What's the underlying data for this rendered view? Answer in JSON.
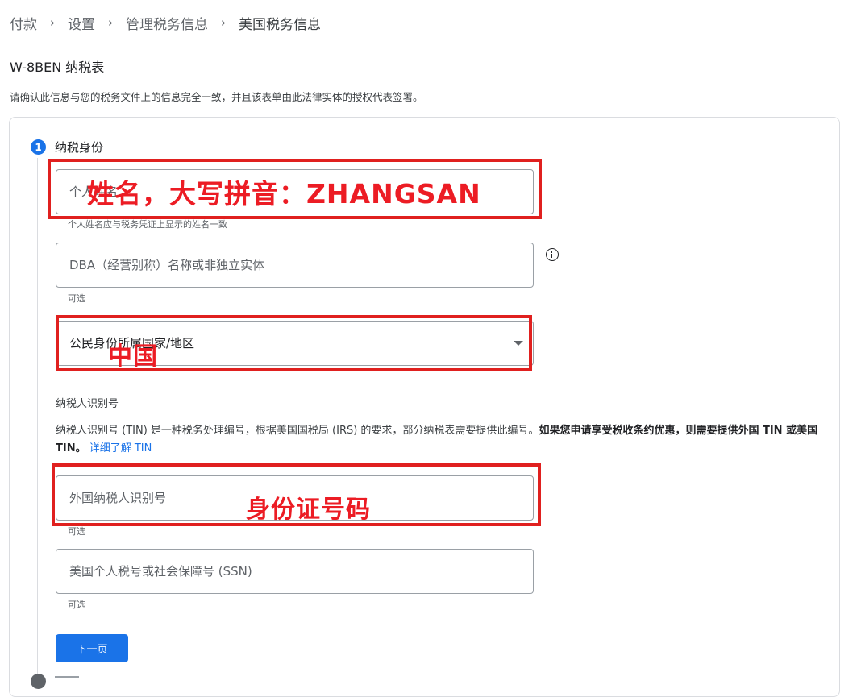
{
  "breadcrumb": {
    "items": [
      "付款",
      "设置",
      "管理税务信息",
      "美国税务信息"
    ],
    "separator": "›"
  },
  "form": {
    "title": "W-8BEN 纳税表",
    "description": "请确认此信息与您的税务文件上的信息完全一致，并且该表单由此法律实体的授权代表签署。"
  },
  "step1": {
    "number": "1",
    "label": "纳税身份",
    "name_field": {
      "placeholder": "个人姓名",
      "helper": "个人姓名应与税务凭证上显示的姓名一致"
    },
    "dba_field": {
      "placeholder": "DBA（经营别称）名称或非独立实体",
      "helper": "可选"
    },
    "country_select": {
      "label": "公民身份所属国家/地区"
    },
    "tin": {
      "heading": "纳税人识别号",
      "description": "纳税人识别号 (TIN) 是一种税务处理编号，根据美国国税局 (IRS) 的要求，部分纳税表需要提供此编号。",
      "description_bold": "如果您申请享受税收条约优惠，则需要提供外国 TIN 或美国 TIN。",
      "learn_more": "详细了解 TIN"
    },
    "foreign_tin_field": {
      "placeholder": "外国纳税人识别号",
      "helper": "可选"
    },
    "ssn_field": {
      "placeholder": "美国个人税号或社会保障号 (SSN)",
      "helper": "可选"
    },
    "next_label": "下一页"
  },
  "annotations": {
    "name": "姓名，大写拼音：ZHANGSAN",
    "country": "中国",
    "tin": "身份证号码",
    "color": "#e0201f"
  },
  "colors": {
    "primary": "#1a73e8",
    "annotation": "#e0201f"
  }
}
